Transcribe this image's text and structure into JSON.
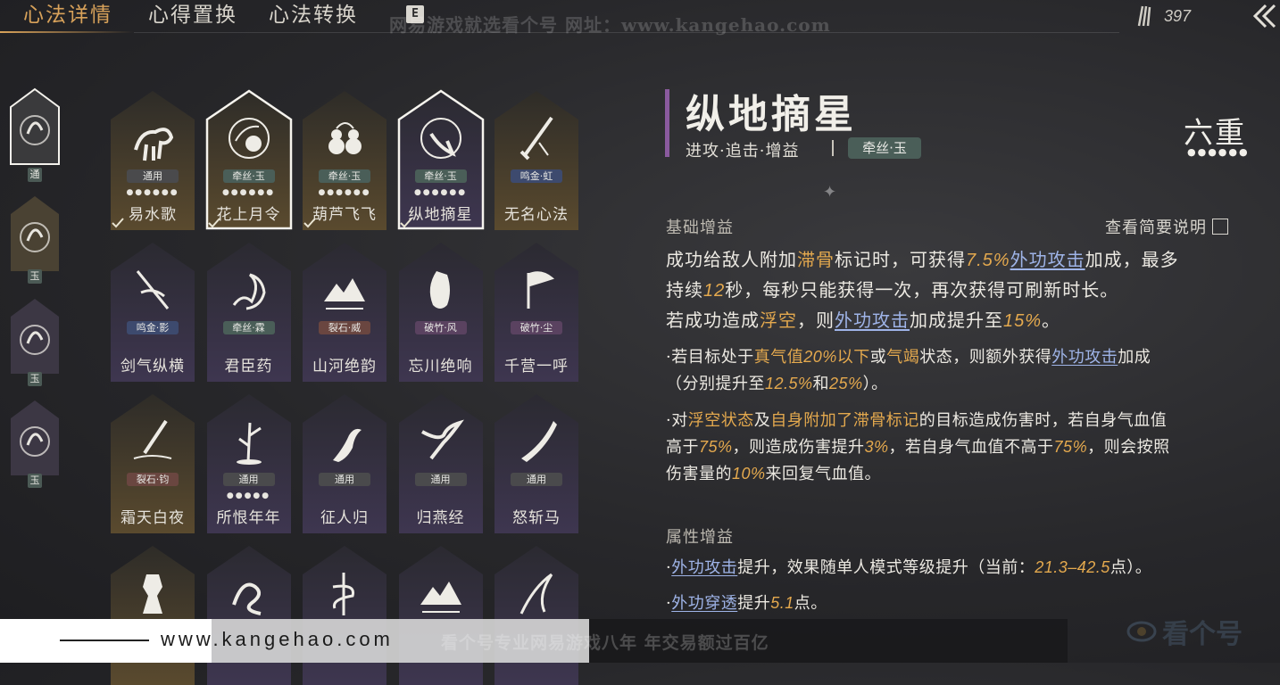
{
  "tabs": [
    {
      "label": "心法详情",
      "active": true
    },
    {
      "label": "心得置换",
      "active": false
    },
    {
      "label": "心法转换",
      "active": false
    }
  ],
  "tab_hotkey": "E",
  "watermark_top": "网易游戏就选看个号   网址：www.kangehao.com",
  "currency": {
    "icon": "arrows-icon",
    "value": "397"
  },
  "back_icon": "double-chevron-left-icon",
  "side_strip": [
    {
      "icon": "ox-icon",
      "badge": "通",
      "selected": true
    },
    {
      "icon": "flower-moon-icon",
      "badge": "玉",
      "selected": false
    },
    {
      "icon": "gourd-icon",
      "badge": "玉",
      "selected": false
    },
    {
      "icon": "star-plucker-icon",
      "badge": "玉",
      "selected": false
    }
  ],
  "cards": [
    {
      "name": "易水歌",
      "tag": "通用",
      "tag_type": "gen",
      "dots": "●●●●●●",
      "equipped": true,
      "tint": "gold",
      "selected": false,
      "art": "ox"
    },
    {
      "name": "花上月令",
      "tag": "牵丝·玉",
      "tag_type": "qy",
      "dots": "●●●●●●",
      "equipped": true,
      "tint": "gold",
      "selected": true,
      "art": "flower"
    },
    {
      "name": "葫芦飞飞",
      "tag": "牵丝·玉",
      "tag_type": "qy",
      "dots": "●●●●●●",
      "equipped": true,
      "tint": "gold",
      "selected": false,
      "art": "gourd"
    },
    {
      "name": "纵地摘星",
      "tag": "牵丝·玉",
      "tag_type": "qy",
      "dots": "●●●●●●",
      "equipped": true,
      "tint": "purple",
      "selected": true,
      "art": "star"
    },
    {
      "name": "无名心法",
      "tag": "鸣金·虹",
      "tag_type": "mj",
      "dots": "",
      "equipped": false,
      "tint": "gold",
      "selected": false,
      "art": "sword"
    },
    {
      "name": "剑气纵横",
      "tag": "鸣金·影",
      "tag_type": "mj",
      "dots": "",
      "equipped": false,
      "tint": "purple",
      "selected": false,
      "art": "blade"
    },
    {
      "name": "君臣药",
      "tag": "牵丝·霖",
      "tag_type": "qy",
      "dots": "",
      "equipped": false,
      "tint": "purple",
      "selected": false,
      "art": "hand"
    },
    {
      "name": "山河绝韵",
      "tag": "裂石·威",
      "tag_type": "lj",
      "dots": "",
      "equipped": false,
      "tint": "purple",
      "selected": false,
      "art": "mountain"
    },
    {
      "name": "忘川绝响",
      "tag": "破竹·风",
      "tag_type": "pz",
      "dots": "",
      "equipped": false,
      "tint": "purple",
      "selected": false,
      "art": "face"
    },
    {
      "name": "千营一呼",
      "tag": "破竹·尘",
      "tag_type": "pz",
      "dots": "",
      "equipped": false,
      "tint": "purple",
      "selected": false,
      "art": "flag"
    },
    {
      "name": "霜天白夜",
      "tag": "裂石·钧",
      "tag_type": "lj",
      "dots": "",
      "equipped": false,
      "tint": "gold",
      "selected": false,
      "art": "pen"
    },
    {
      "name": "所恨年年",
      "tag": "通用",
      "tag_type": "gen",
      "dots": "●●●●●",
      "equipped": false,
      "tint": "purple",
      "selected": false,
      "art": "bamboo"
    },
    {
      "name": "征人归",
      "tag": "通用",
      "tag_type": "gen",
      "dots": "",
      "equipped": false,
      "tint": "purple",
      "selected": false,
      "art": "bird"
    },
    {
      "name": "归燕经",
      "tag": "通用",
      "tag_type": "gen",
      "dots": "",
      "equipped": false,
      "tint": "purple",
      "selected": false,
      "art": "swallow"
    },
    {
      "name": "怒斩马",
      "tag": "通用",
      "tag_type": "gen",
      "dots": "",
      "equipped": false,
      "tint": "purple",
      "selected": false,
      "art": "sabre"
    },
    {
      "name": "",
      "tag": "",
      "tag_type": "",
      "dots": "",
      "equipped": false,
      "tint": "gold",
      "selected": false,
      "art": "statue"
    },
    {
      "name": "",
      "tag": "",
      "tag_type": "",
      "dots": "",
      "equipped": false,
      "tint": "purple",
      "selected": false,
      "art": "dragon"
    },
    {
      "name": "",
      "tag": "",
      "tag_type": "",
      "dots": "",
      "equipped": false,
      "tint": "purple",
      "selected": false,
      "art": "snake"
    },
    {
      "name": "",
      "tag": "",
      "tag_type": "",
      "dots": "",
      "equipped": false,
      "tint": "purple",
      "selected": false,
      "art": "mountain"
    },
    {
      "name": "",
      "tag": "",
      "tag_type": "",
      "dots": "",
      "equipped": false,
      "tint": "purple",
      "selected": false,
      "art": "scythe"
    }
  ],
  "detail": {
    "title": "纵地摘星",
    "tags": "进攻·追击·增益",
    "gem": "牵丝·玉",
    "level": "六重",
    "level_dots": "●●●●●●",
    "basic_title": "基础增益",
    "view_brief": "查看简要说明",
    "attr_title": "属性增益"
  },
  "text": {
    "l1a": "成功给敌人附加",
    "l1b": "滞骨",
    "l1c": "标记时，可获得",
    "l1d": "7.5%",
    "l1e": "外功攻击",
    "l1f": "加成，最多",
    "l2a": "持续",
    "l2b": "12",
    "l2c": "秒，每秒只能获得一次，再次获得可刷新时长。",
    "l3a": "若成功造成",
    "l3b": "浮空",
    "l3c": "，则",
    "l3d": "外功攻击",
    "l3e": "加成提升至",
    "l3f": "15%",
    "l3g": "。",
    "l4a": "·若目标处于",
    "l4b": "真气值",
    "l4c": "20%",
    "l4d": "以下",
    "l4e": "或",
    "l4f": "气竭",
    "l4g": "状态，则额外获得",
    "l4h": "外功攻击",
    "l4i": "加成",
    "l5a": "（分别提升至",
    "l5b": "12.5%",
    "l5c": "和",
    "l5d": "25%",
    "l5e": "）。",
    "l6a": "·对",
    "l6b": "浮空状态",
    "l6c": "及",
    "l6d": "自身附加了滞骨标记",
    "l6e": "的目标造成伤害时，若自身气血值",
    "l7a": "高于",
    "l7b": "75%",
    "l7c": "，则造成伤害提升",
    "l7d": "3%",
    "l7e": "，若自身气血值不高于",
    "l7f": "75%",
    "l7g": "，则会按照",
    "l8a": "伤害量的",
    "l8b": "10%",
    "l8c": "来回复气血值。",
    "a1a": "·",
    "a1b": "外功攻击",
    "a1c": "提升，效果随单人模式等级提升（当前：",
    "a1d": "21.3–42.5",
    "a1e": "点）。",
    "a2a": "·",
    "a2b": "外功穿透",
    "a2c": "提升",
    "a2d": "5.1",
    "a2e": "点。"
  },
  "overlay": {
    "url": "www.kangehao.com",
    "slogan": "看个号专业网易游戏八年  年交易额过百亿",
    "logo": "看个号"
  },
  "colors": {
    "accent": "#d8a25a",
    "highlight": "#e4a94e",
    "link": "#9fb4e8",
    "title_bar": "#8a5a9e"
  }
}
